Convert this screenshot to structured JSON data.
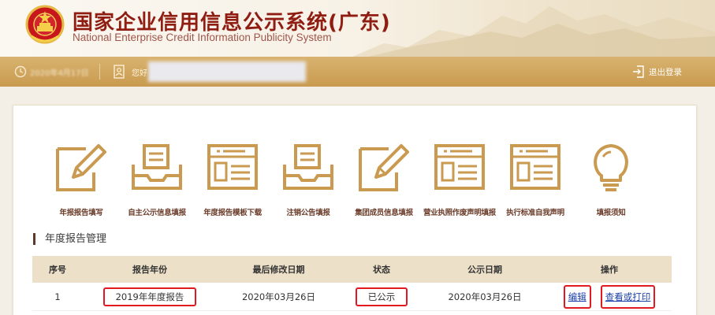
{
  "header": {
    "title": "国家企业信用信息公示系统(广东)",
    "subtitle": "National Enterprise Credit Information Publicity System"
  },
  "topbar": {
    "date": "2020年4月17日",
    "greeting": "您好",
    "logout_label": "退出登录",
    "icons": {
      "clock": "clock-icon",
      "user": "user-card-icon",
      "logout": "logout-icon"
    }
  },
  "functions": [
    {
      "label": "年报报告填写",
      "icon": "edit-form-icon"
    },
    {
      "label": "自主公示信息填报",
      "icon": "tray-document-icon"
    },
    {
      "label": "年度报告模板下载",
      "icon": "template-icon"
    },
    {
      "label": "注销公告填报",
      "icon": "tray-document-icon"
    },
    {
      "label": "集团成员信息填报",
      "icon": "edit-form-icon"
    },
    {
      "label": "营业执照作废声明填报",
      "icon": "template-icon"
    },
    {
      "label": "执行标准自我声明",
      "icon": "template-icon"
    },
    {
      "label": "填报须知",
      "icon": "lightbulb-icon"
    }
  ],
  "section": {
    "title": "年度报告管理"
  },
  "table": {
    "headers": [
      "序号",
      "报告年份",
      "最后修改日期",
      "状态",
      "公示日期",
      "操作"
    ],
    "rows": [
      {
        "index": "1",
        "year": "2019年年度报告",
        "modified": "2020年03月26日",
        "status": "已公示",
        "publish_date": "2020年03月26日",
        "actions": [
          "编辑",
          "查看或打印"
        ]
      }
    ]
  },
  "colors": {
    "brand_red": "#8f1d12",
    "gold_bar": "#c99a4f",
    "icon_gold": "#c99a4f",
    "highlight_red": "#e11a22",
    "link_blue": "#1a3fa8"
  }
}
